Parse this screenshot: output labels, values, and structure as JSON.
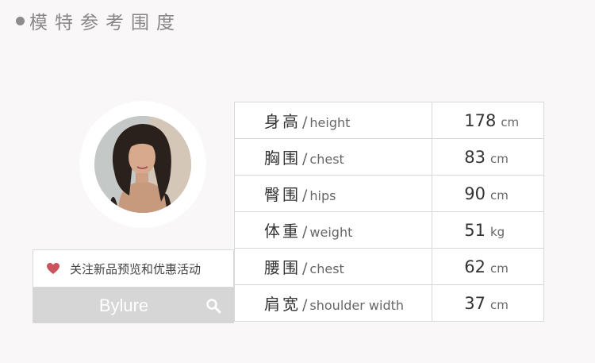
{
  "header": {
    "title": "模特参考围度"
  },
  "follow": {
    "label": "关注新品预览和优惠活动"
  },
  "search": {
    "brand": "Bylure"
  },
  "table": {
    "rows": [
      {
        "zh": "身高",
        "sep": "/",
        "en": "height",
        "value": "178",
        "unit": "cm"
      },
      {
        "zh": "胸围",
        "sep": "/",
        "en": "chest",
        "value": "83",
        "unit": "cm"
      },
      {
        "zh": "臀围",
        "sep": "/",
        "en": "hips",
        "value": "90",
        "unit": "cm"
      },
      {
        "zh": "体重",
        "sep": "/",
        "en": "weight",
        "value": "51",
        "unit": "kg"
      },
      {
        "zh": "腰围",
        "sep": "/",
        "en": "chest",
        "value": "62",
        "unit": "cm"
      },
      {
        "zh": "肩宽",
        "sep": "/",
        "en": "shoulder width",
        "value": "37",
        "unit": "cm"
      }
    ]
  },
  "colors": {
    "accent_heart": "#c9545e",
    "search_bg": "#d6d6d6",
    "page_bg": "#f9f7f8"
  },
  "icons": {
    "bullet": "dot-icon",
    "follow": "heart-icon",
    "search": "search-icon"
  }
}
